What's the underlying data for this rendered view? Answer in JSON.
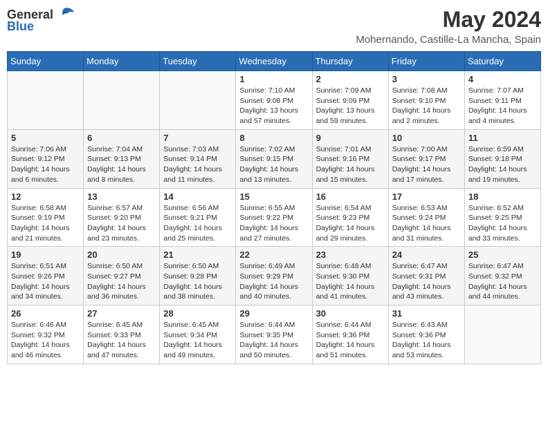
{
  "header": {
    "logo_general": "General",
    "logo_blue": "Blue",
    "title": "May 2024",
    "subtitle": "Mohernando, Castille-La Mancha, Spain"
  },
  "days_of_week": [
    "Sunday",
    "Monday",
    "Tuesday",
    "Wednesday",
    "Thursday",
    "Friday",
    "Saturday"
  ],
  "weeks": [
    {
      "days": [
        {
          "number": "",
          "sunrise": "",
          "sunset": "",
          "daylight": ""
        },
        {
          "number": "",
          "sunrise": "",
          "sunset": "",
          "daylight": ""
        },
        {
          "number": "",
          "sunrise": "",
          "sunset": "",
          "daylight": ""
        },
        {
          "number": "1",
          "sunrise": "Sunrise: 7:10 AM",
          "sunset": "Sunset: 9:08 PM",
          "daylight": "Daylight: 13 hours and 57 minutes."
        },
        {
          "number": "2",
          "sunrise": "Sunrise: 7:09 AM",
          "sunset": "Sunset: 9:09 PM",
          "daylight": "Daylight: 13 hours and 59 minutes."
        },
        {
          "number": "3",
          "sunrise": "Sunrise: 7:08 AM",
          "sunset": "Sunset: 9:10 PM",
          "daylight": "Daylight: 14 hours and 2 minutes."
        },
        {
          "number": "4",
          "sunrise": "Sunrise: 7:07 AM",
          "sunset": "Sunset: 9:11 PM",
          "daylight": "Daylight: 14 hours and 4 minutes."
        }
      ]
    },
    {
      "days": [
        {
          "number": "5",
          "sunrise": "Sunrise: 7:06 AM",
          "sunset": "Sunset: 9:12 PM",
          "daylight": "Daylight: 14 hours and 6 minutes."
        },
        {
          "number": "6",
          "sunrise": "Sunrise: 7:04 AM",
          "sunset": "Sunset: 9:13 PM",
          "daylight": "Daylight: 14 hours and 8 minutes."
        },
        {
          "number": "7",
          "sunrise": "Sunrise: 7:03 AM",
          "sunset": "Sunset: 9:14 PM",
          "daylight": "Daylight: 14 hours and 11 minutes."
        },
        {
          "number": "8",
          "sunrise": "Sunrise: 7:02 AM",
          "sunset": "Sunset: 9:15 PM",
          "daylight": "Daylight: 14 hours and 13 minutes."
        },
        {
          "number": "9",
          "sunrise": "Sunrise: 7:01 AM",
          "sunset": "Sunset: 9:16 PM",
          "daylight": "Daylight: 14 hours and 15 minutes."
        },
        {
          "number": "10",
          "sunrise": "Sunrise: 7:00 AM",
          "sunset": "Sunset: 9:17 PM",
          "daylight": "Daylight: 14 hours and 17 minutes."
        },
        {
          "number": "11",
          "sunrise": "Sunrise: 6:59 AM",
          "sunset": "Sunset: 9:18 PM",
          "daylight": "Daylight: 14 hours and 19 minutes."
        }
      ]
    },
    {
      "days": [
        {
          "number": "12",
          "sunrise": "Sunrise: 6:58 AM",
          "sunset": "Sunset: 9:19 PM",
          "daylight": "Daylight: 14 hours and 21 minutes."
        },
        {
          "number": "13",
          "sunrise": "Sunrise: 6:57 AM",
          "sunset": "Sunset: 9:20 PM",
          "daylight": "Daylight: 14 hours and 23 minutes."
        },
        {
          "number": "14",
          "sunrise": "Sunrise: 6:56 AM",
          "sunset": "Sunset: 9:21 PM",
          "daylight": "Daylight: 14 hours and 25 minutes."
        },
        {
          "number": "15",
          "sunrise": "Sunrise: 6:55 AM",
          "sunset": "Sunset: 9:22 PM",
          "daylight": "Daylight: 14 hours and 27 minutes."
        },
        {
          "number": "16",
          "sunrise": "Sunrise: 6:54 AM",
          "sunset": "Sunset: 9:23 PM",
          "daylight": "Daylight: 14 hours and 29 minutes."
        },
        {
          "number": "17",
          "sunrise": "Sunrise: 6:53 AM",
          "sunset": "Sunset: 9:24 PM",
          "daylight": "Daylight: 14 hours and 31 minutes."
        },
        {
          "number": "18",
          "sunrise": "Sunrise: 6:52 AM",
          "sunset": "Sunset: 9:25 PM",
          "daylight": "Daylight: 14 hours and 33 minutes."
        }
      ]
    },
    {
      "days": [
        {
          "number": "19",
          "sunrise": "Sunrise: 6:51 AM",
          "sunset": "Sunset: 9:26 PM",
          "daylight": "Daylight: 14 hours and 34 minutes."
        },
        {
          "number": "20",
          "sunrise": "Sunrise: 6:50 AM",
          "sunset": "Sunset: 9:27 PM",
          "daylight": "Daylight: 14 hours and 36 minutes."
        },
        {
          "number": "21",
          "sunrise": "Sunrise: 6:50 AM",
          "sunset": "Sunset: 9:28 PM",
          "daylight": "Daylight: 14 hours and 38 minutes."
        },
        {
          "number": "22",
          "sunrise": "Sunrise: 6:49 AM",
          "sunset": "Sunset: 9:29 PM",
          "daylight": "Daylight: 14 hours and 40 minutes."
        },
        {
          "number": "23",
          "sunrise": "Sunrise: 6:48 AM",
          "sunset": "Sunset: 9:30 PM",
          "daylight": "Daylight: 14 hours and 41 minutes."
        },
        {
          "number": "24",
          "sunrise": "Sunrise: 6:47 AM",
          "sunset": "Sunset: 9:31 PM",
          "daylight": "Daylight: 14 hours and 43 minutes."
        },
        {
          "number": "25",
          "sunrise": "Sunrise: 6:47 AM",
          "sunset": "Sunset: 9:32 PM",
          "daylight": "Daylight: 14 hours and 44 minutes."
        }
      ]
    },
    {
      "days": [
        {
          "number": "26",
          "sunrise": "Sunrise: 6:46 AM",
          "sunset": "Sunset: 9:32 PM",
          "daylight": "Daylight: 14 hours and 46 minutes."
        },
        {
          "number": "27",
          "sunrise": "Sunrise: 6:45 AM",
          "sunset": "Sunset: 9:33 PM",
          "daylight": "Daylight: 14 hours and 47 minutes."
        },
        {
          "number": "28",
          "sunrise": "Sunrise: 6:45 AM",
          "sunset": "Sunset: 9:34 PM",
          "daylight": "Daylight: 14 hours and 49 minutes."
        },
        {
          "number": "29",
          "sunrise": "Sunrise: 6:44 AM",
          "sunset": "Sunset: 9:35 PM",
          "daylight": "Daylight: 14 hours and 50 minutes."
        },
        {
          "number": "30",
          "sunrise": "Sunrise: 6:44 AM",
          "sunset": "Sunset: 9:36 PM",
          "daylight": "Daylight: 14 hours and 51 minutes."
        },
        {
          "number": "31",
          "sunrise": "Sunrise: 6:43 AM",
          "sunset": "Sunset: 9:36 PM",
          "daylight": "Daylight: 14 hours and 53 minutes."
        },
        {
          "number": "",
          "sunrise": "",
          "sunset": "",
          "daylight": ""
        }
      ]
    }
  ]
}
